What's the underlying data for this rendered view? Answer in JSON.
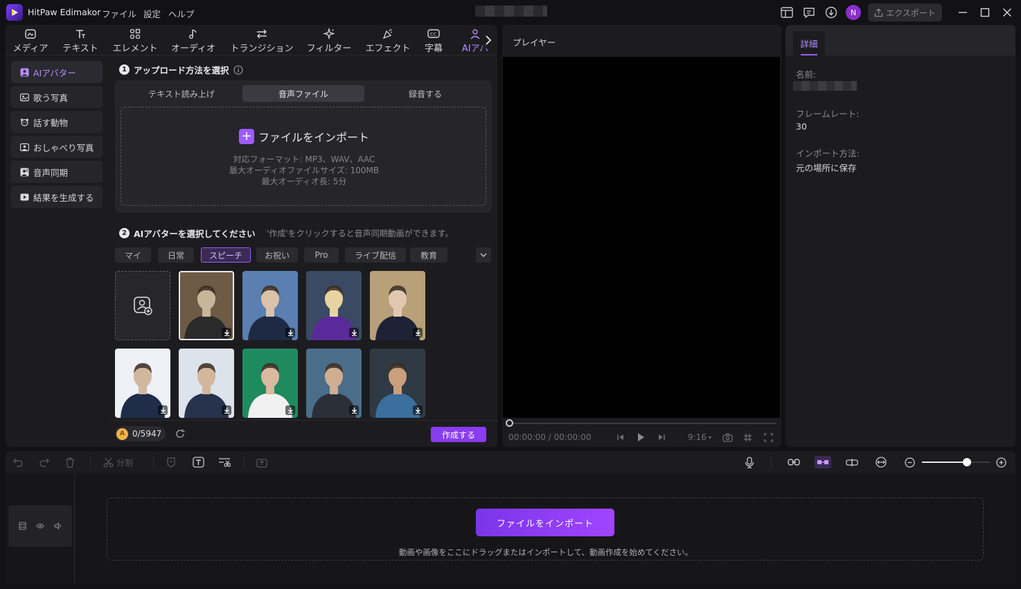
{
  "app": {
    "title": "HitPaw Edimakor"
  },
  "menu": [
    "ファイル",
    "設定",
    "ヘルプ"
  ],
  "user": {
    "initial": "N"
  },
  "export_label": "エクスポート",
  "toolbar_tabs": [
    {
      "label": "メディア",
      "icon": "media-icon"
    },
    {
      "label": "テキスト",
      "icon": "text-icon"
    },
    {
      "label": "エレメント",
      "icon": "element-icon"
    },
    {
      "label": "オーディオ",
      "icon": "audio-icon"
    },
    {
      "label": "トランジション",
      "icon": "transition-icon"
    },
    {
      "label": "フィルター",
      "icon": "filter-icon"
    },
    {
      "label": "エフェクト",
      "icon": "effect-icon"
    },
    {
      "label": "字幕",
      "icon": "subtitle-icon"
    },
    {
      "label": "AIアバ",
      "icon": "ai-avatar-icon"
    }
  ],
  "side_nav": [
    {
      "label": "AIアバター",
      "active": true
    },
    {
      "label": "歌う写真"
    },
    {
      "label": "話す動物"
    },
    {
      "label": "おしゃべり写真"
    },
    {
      "label": "音声同期"
    },
    {
      "label": "結果を生成する"
    }
  ],
  "step1": {
    "number": "1",
    "title": "アップロード方法を選択",
    "mode_tabs": [
      "テキスト読み上げ",
      "音声ファイル",
      "録音する"
    ],
    "active_mode": "音声ファイル",
    "import_label": "ファイルをインポート",
    "formats": "対応フォーマット: MP3、WAV、AAC",
    "max_size": "最大オーディオファイルサイズ: 100MB",
    "max_length": "最大オーディオ長: 5分"
  },
  "step2": {
    "number": "2",
    "title": "AIアバターを選択してください",
    "hint": "'作成'をクリックすると音声同期動画ができます。",
    "categories": [
      "マイ",
      "日常",
      "スピーチ",
      "お祝い",
      "Pro",
      "ライブ配信",
      "教育"
    ],
    "active_category": "スピーチ"
  },
  "avatars_row1": [
    {
      "name": "avatar-woman-speaker",
      "colors": [
        "#6e5a45",
        "#c9b59a",
        "#2a2a2a"
      ]
    },
    {
      "name": "avatar-man-blue-suit",
      "colors": [
        "#5a7fb0",
        "#d9c2a8",
        "#1e2a44"
      ]
    },
    {
      "name": "avatar-graduate",
      "colors": [
        "#3a4a63",
        "#e8d3a0",
        "#5b2a9a"
      ]
    },
    {
      "name": "avatar-woman-navy",
      "colors": [
        "#b8a078",
        "#e1c7b0",
        "#1d2236"
      ]
    }
  ],
  "avatars_row2": [
    {
      "name": "avatar-man-gray-hair",
      "colors": [
        "#eef1f5",
        "#d2b7a0",
        "#1f2c4a"
      ]
    },
    {
      "name": "avatar-man-glasses",
      "colors": [
        "#dde3ea",
        "#d4b69c",
        "#27324c"
      ]
    },
    {
      "name": "avatar-woman-green",
      "colors": [
        "#1f8a5e",
        "#d9b9a0",
        "#f1f1f1"
      ]
    },
    {
      "name": "avatar-man-podium",
      "colors": [
        "#4a6e8a",
        "#cfae92",
        "#2b2f38"
      ]
    },
    {
      "name": "avatar-man-denim",
      "colors": [
        "#2f3a44",
        "#c99f7c",
        "#3a6f9e"
      ]
    }
  ],
  "footer": {
    "credits": "0/5947",
    "create_label": "作成する"
  },
  "player": {
    "title": "プレイヤー",
    "time": "00:00:00 / 00:00:00",
    "aspect": "9:16"
  },
  "details": {
    "tab": "詳細",
    "name_label": "名前:",
    "framerate_label": "フレームレート:",
    "framerate_value": "30",
    "import_label": "インポート方法:",
    "import_value": "元の場所に保存"
  },
  "timeline_toolbar": {
    "split_label": "分割",
    "zoom_level": 0.66
  },
  "timeline": {
    "import_label": "ファイルをインポート",
    "hint": "動画や画像をここにドラッグまたはインポートして、動画作成を始めてください。"
  },
  "accent": "#9d5cff"
}
